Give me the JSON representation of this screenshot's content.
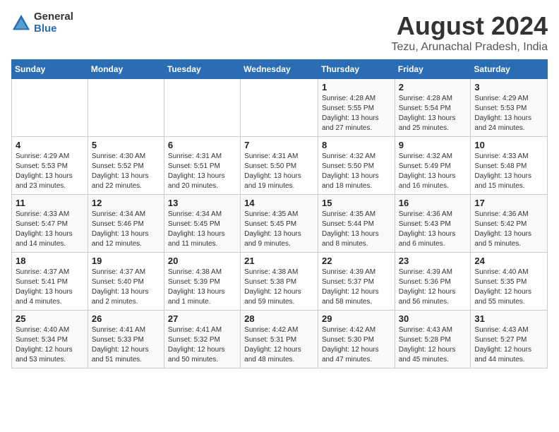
{
  "header": {
    "logo_general": "General",
    "logo_blue": "Blue",
    "title": "August 2024",
    "subtitle": "Tezu, Arunachal Pradesh, India"
  },
  "weekdays": [
    "Sunday",
    "Monday",
    "Tuesday",
    "Wednesday",
    "Thursday",
    "Friday",
    "Saturday"
  ],
  "weeks": [
    [
      {
        "day": "",
        "detail": ""
      },
      {
        "day": "",
        "detail": ""
      },
      {
        "day": "",
        "detail": ""
      },
      {
        "day": "",
        "detail": ""
      },
      {
        "day": "1",
        "detail": "Sunrise: 4:28 AM\nSunset: 5:55 PM\nDaylight: 13 hours and 27 minutes."
      },
      {
        "day": "2",
        "detail": "Sunrise: 4:28 AM\nSunset: 5:54 PM\nDaylight: 13 hours and 25 minutes."
      },
      {
        "day": "3",
        "detail": "Sunrise: 4:29 AM\nSunset: 5:53 PM\nDaylight: 13 hours and 24 minutes."
      }
    ],
    [
      {
        "day": "4",
        "detail": "Sunrise: 4:29 AM\nSunset: 5:53 PM\nDaylight: 13 hours and 23 minutes."
      },
      {
        "day": "5",
        "detail": "Sunrise: 4:30 AM\nSunset: 5:52 PM\nDaylight: 13 hours and 22 minutes."
      },
      {
        "day": "6",
        "detail": "Sunrise: 4:31 AM\nSunset: 5:51 PM\nDaylight: 13 hours and 20 minutes."
      },
      {
        "day": "7",
        "detail": "Sunrise: 4:31 AM\nSunset: 5:50 PM\nDaylight: 13 hours and 19 minutes."
      },
      {
        "day": "8",
        "detail": "Sunrise: 4:32 AM\nSunset: 5:50 PM\nDaylight: 13 hours and 18 minutes."
      },
      {
        "day": "9",
        "detail": "Sunrise: 4:32 AM\nSunset: 5:49 PM\nDaylight: 13 hours and 16 minutes."
      },
      {
        "day": "10",
        "detail": "Sunrise: 4:33 AM\nSunset: 5:48 PM\nDaylight: 13 hours and 15 minutes."
      }
    ],
    [
      {
        "day": "11",
        "detail": "Sunrise: 4:33 AM\nSunset: 5:47 PM\nDaylight: 13 hours and 14 minutes."
      },
      {
        "day": "12",
        "detail": "Sunrise: 4:34 AM\nSunset: 5:46 PM\nDaylight: 13 hours and 12 minutes."
      },
      {
        "day": "13",
        "detail": "Sunrise: 4:34 AM\nSunset: 5:45 PM\nDaylight: 13 hours and 11 minutes."
      },
      {
        "day": "14",
        "detail": "Sunrise: 4:35 AM\nSunset: 5:45 PM\nDaylight: 13 hours and 9 minutes."
      },
      {
        "day": "15",
        "detail": "Sunrise: 4:35 AM\nSunset: 5:44 PM\nDaylight: 13 hours and 8 minutes."
      },
      {
        "day": "16",
        "detail": "Sunrise: 4:36 AM\nSunset: 5:43 PM\nDaylight: 13 hours and 6 minutes."
      },
      {
        "day": "17",
        "detail": "Sunrise: 4:36 AM\nSunset: 5:42 PM\nDaylight: 13 hours and 5 minutes."
      }
    ],
    [
      {
        "day": "18",
        "detail": "Sunrise: 4:37 AM\nSunset: 5:41 PM\nDaylight: 13 hours and 4 minutes."
      },
      {
        "day": "19",
        "detail": "Sunrise: 4:37 AM\nSunset: 5:40 PM\nDaylight: 13 hours and 2 minutes."
      },
      {
        "day": "20",
        "detail": "Sunrise: 4:38 AM\nSunset: 5:39 PM\nDaylight: 13 hours and 1 minute."
      },
      {
        "day": "21",
        "detail": "Sunrise: 4:38 AM\nSunset: 5:38 PM\nDaylight: 12 hours and 59 minutes."
      },
      {
        "day": "22",
        "detail": "Sunrise: 4:39 AM\nSunset: 5:37 PM\nDaylight: 12 hours and 58 minutes."
      },
      {
        "day": "23",
        "detail": "Sunrise: 4:39 AM\nSunset: 5:36 PM\nDaylight: 12 hours and 56 minutes."
      },
      {
        "day": "24",
        "detail": "Sunrise: 4:40 AM\nSunset: 5:35 PM\nDaylight: 12 hours and 55 minutes."
      }
    ],
    [
      {
        "day": "25",
        "detail": "Sunrise: 4:40 AM\nSunset: 5:34 PM\nDaylight: 12 hours and 53 minutes."
      },
      {
        "day": "26",
        "detail": "Sunrise: 4:41 AM\nSunset: 5:33 PM\nDaylight: 12 hours and 51 minutes."
      },
      {
        "day": "27",
        "detail": "Sunrise: 4:41 AM\nSunset: 5:32 PM\nDaylight: 12 hours and 50 minutes."
      },
      {
        "day": "28",
        "detail": "Sunrise: 4:42 AM\nSunset: 5:31 PM\nDaylight: 12 hours and 48 minutes."
      },
      {
        "day": "29",
        "detail": "Sunrise: 4:42 AM\nSunset: 5:30 PM\nDaylight: 12 hours and 47 minutes."
      },
      {
        "day": "30",
        "detail": "Sunrise: 4:43 AM\nSunset: 5:28 PM\nDaylight: 12 hours and 45 minutes."
      },
      {
        "day": "31",
        "detail": "Sunrise: 4:43 AM\nSunset: 5:27 PM\nDaylight: 12 hours and 44 minutes."
      }
    ]
  ]
}
